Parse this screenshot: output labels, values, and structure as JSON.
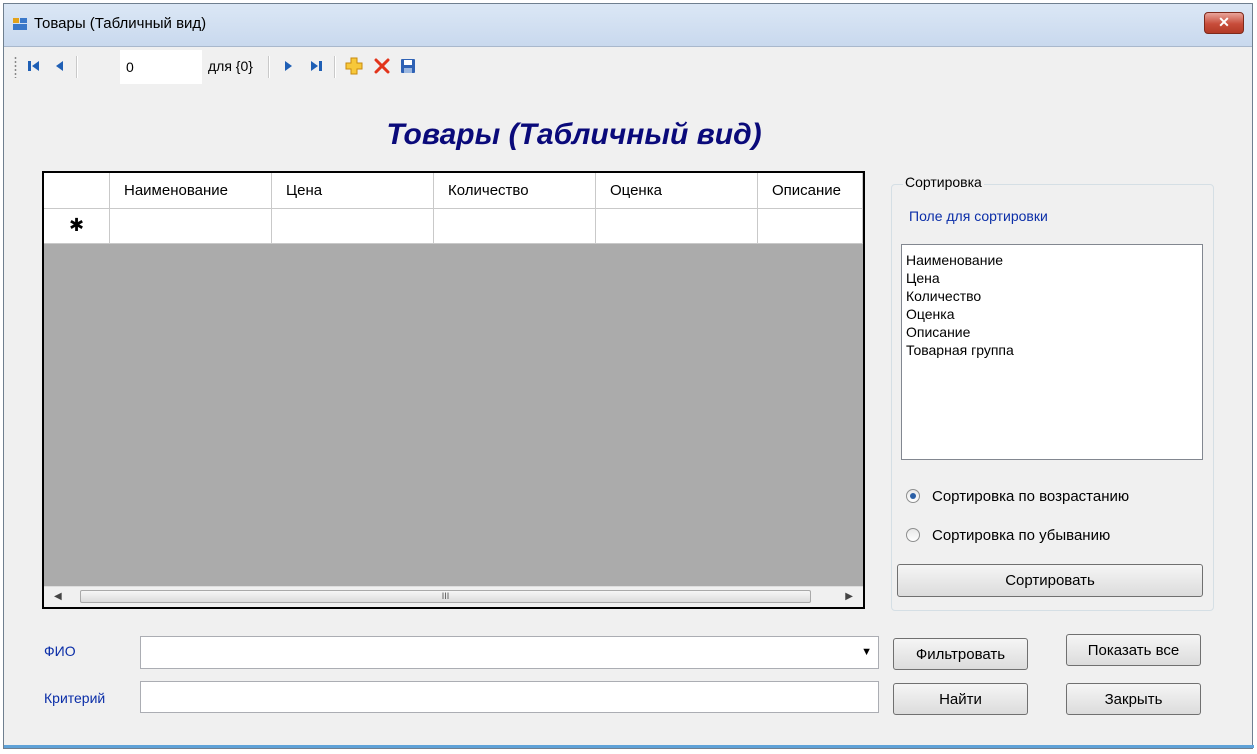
{
  "window": {
    "title": "Товары (Табличный вид)",
    "close_label": "✕"
  },
  "navigator": {
    "position_value": "0",
    "count_label": "для {0}"
  },
  "form_title": "Товары (Табличный вид)",
  "grid": {
    "columns": [
      "Наименование",
      "Цена",
      "Количество",
      "Оценка",
      "Описание"
    ],
    "new_row_marker": "✱",
    "scroll_thumb_grip": "III"
  },
  "sort": {
    "group_title": "Сортировка",
    "field_label": "Поле для сортировки",
    "fields": [
      "Наименование",
      "Цена",
      "Количество",
      "Оценка",
      "Описание",
      "Товарная группа"
    ],
    "ascending_label": "Сортировка по возрастанию",
    "descending_label": "Сортировка по убыванию",
    "selected": "ascending",
    "button_label": "Сортировать"
  },
  "filter": {
    "fio_label": "ФИО",
    "fio_value": "",
    "criteria_label": "Критерий",
    "criteria_value": "",
    "filter_button": "Фильтровать",
    "show_all_button": "Показать все",
    "find_button": "Найти",
    "close_button": "Закрыть"
  },
  "colors": {
    "title_blue": "#0a0a7a",
    "label_blue": "#0b2ea8",
    "grid_bg": "#ababab"
  }
}
